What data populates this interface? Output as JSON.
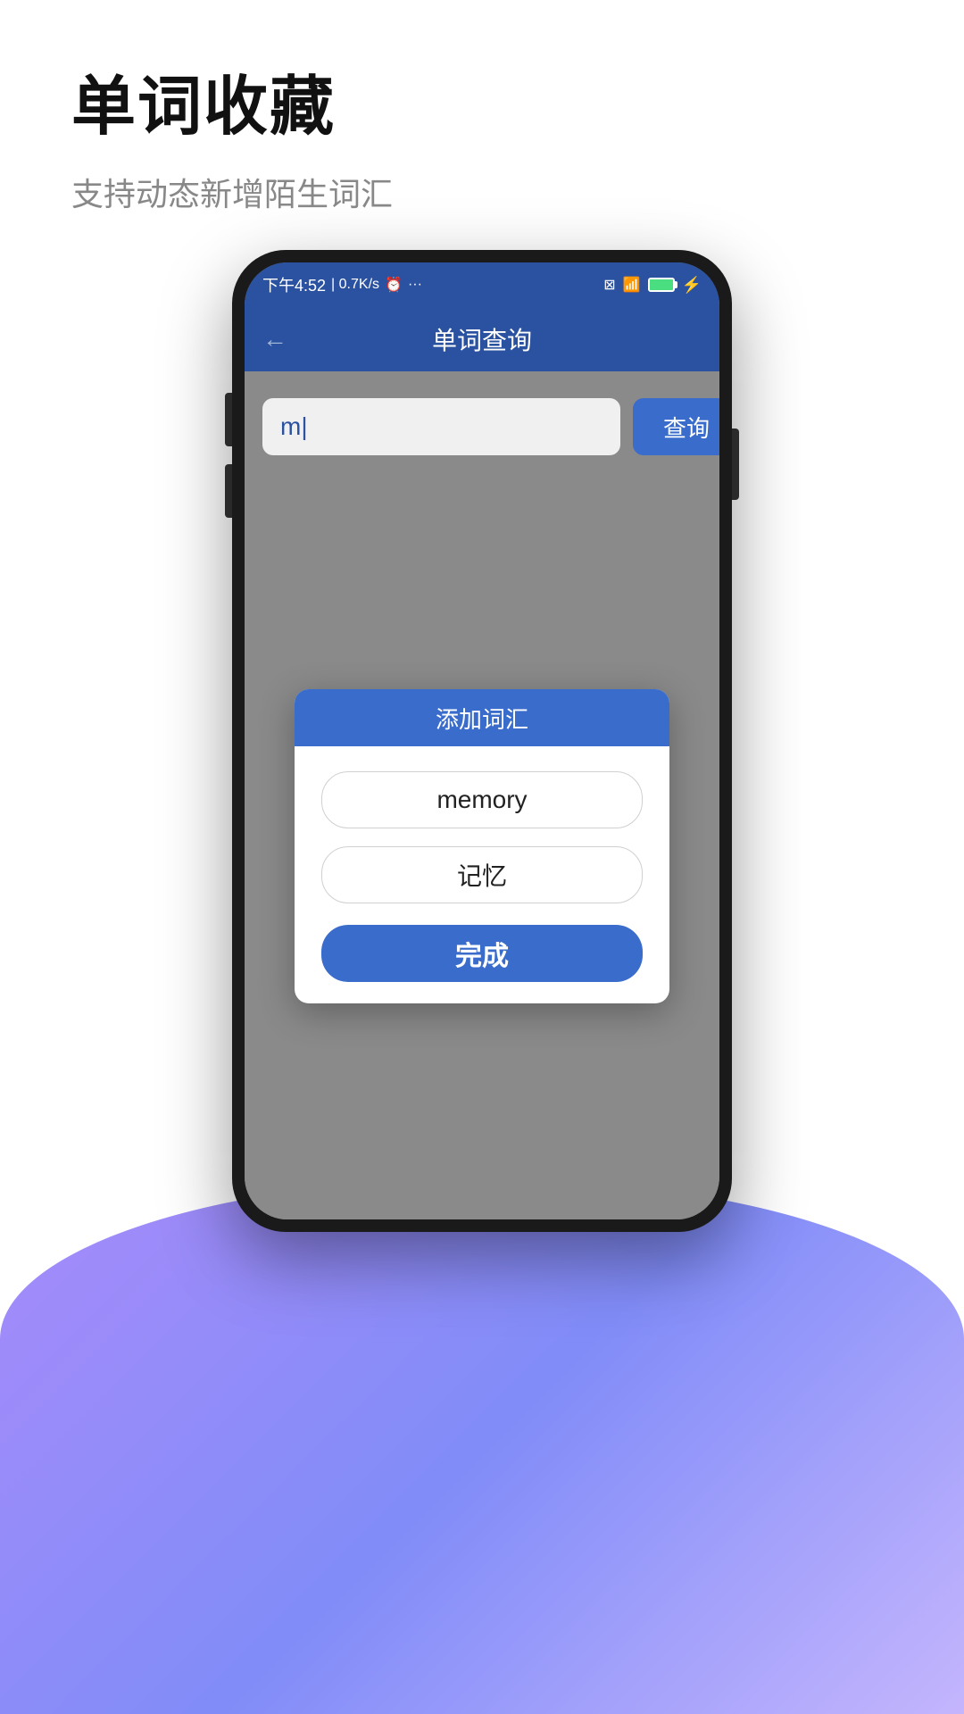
{
  "page": {
    "title": "单词收藏",
    "subtitle": "支持动态新增陌生词汇"
  },
  "statusBar": {
    "time": "下午4:52",
    "speed": "0.7K/s",
    "icons": "⏰ ···"
  },
  "appHeader": {
    "title": "单词查询",
    "backLabel": "←"
  },
  "search": {
    "inputValue": "m|",
    "buttonLabel": "查询",
    "placeholder": ""
  },
  "dialog": {
    "title": "添加词汇",
    "wordLabel": "memory",
    "translationLabel": "记忆",
    "confirmLabel": "完成"
  }
}
